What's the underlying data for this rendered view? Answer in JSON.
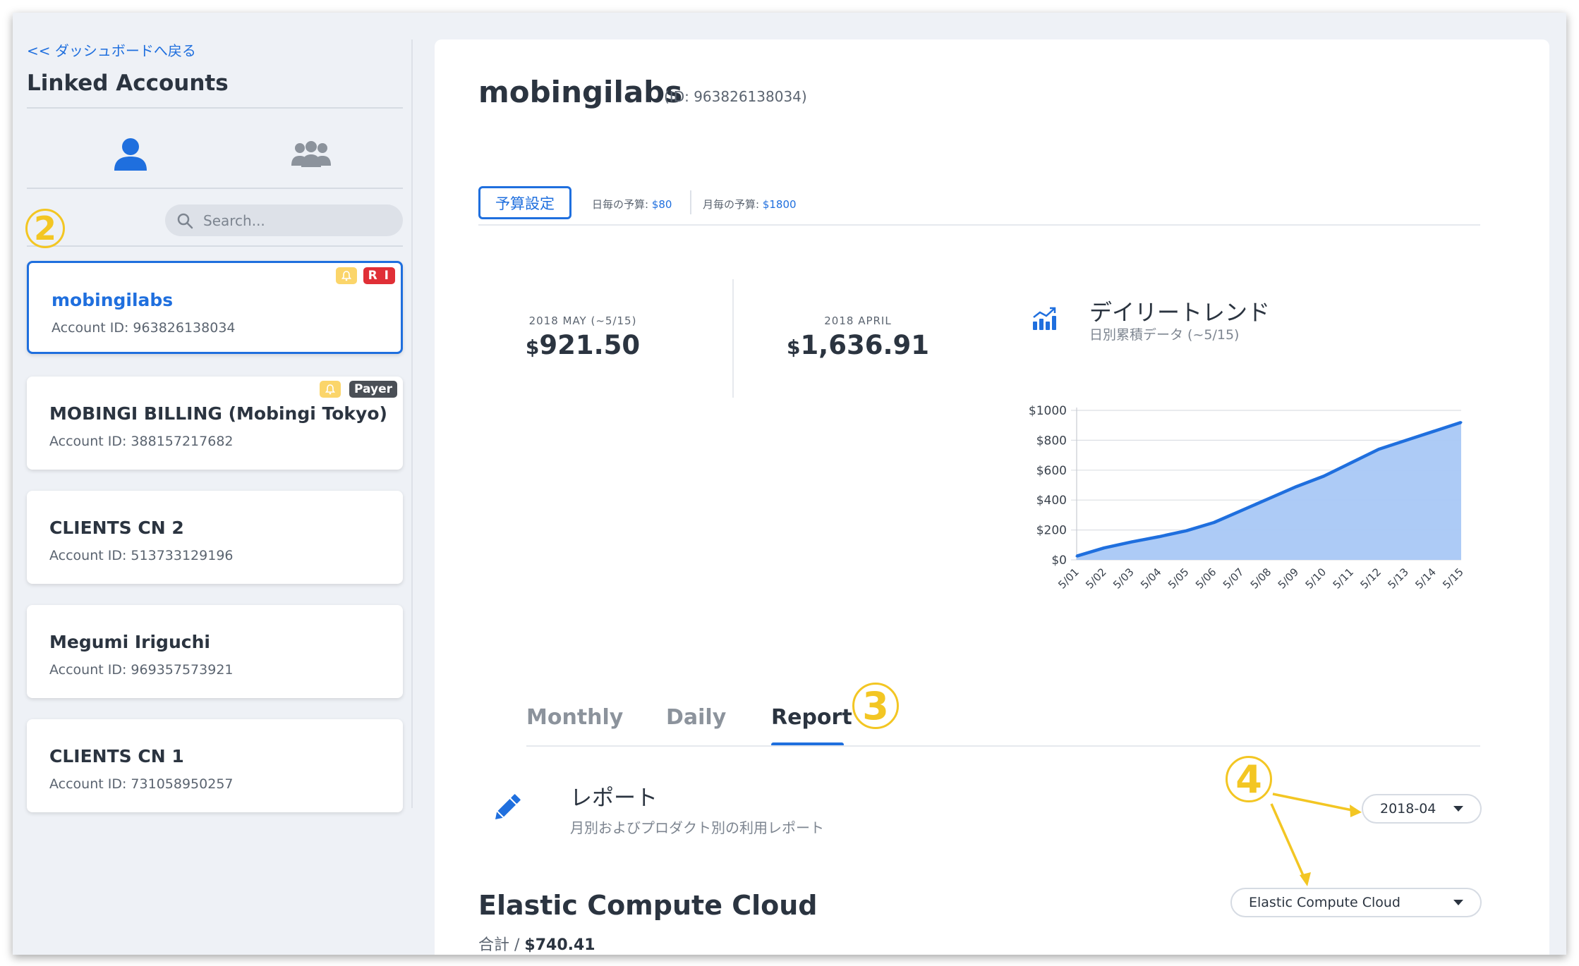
{
  "sidebar": {
    "back_link": "<< ダッシュボードへ戻る",
    "title": "Linked Accounts",
    "search_placeholder": "Search...",
    "accounts": [
      {
        "name": "mobingilabs",
        "id_label": "Account ID: 963826138034",
        "badge": "R I",
        "badge_color": "#e02f36",
        "bell": true,
        "active": true
      },
      {
        "name": "MOBINGI BILLING (Mobingi Tokyo)",
        "id_label": "Account ID: 388157217682",
        "badge": "Payer",
        "badge_color": "#4a4f56",
        "bell": true,
        "active": false
      },
      {
        "name": "CLIENTS CN 2",
        "id_label": "Account ID: 513733129196",
        "active": false
      },
      {
        "name": "Megumi Iriguchi",
        "id_label": "Account ID: 969357573921",
        "active": false
      },
      {
        "name": "CLIENTS CN 1",
        "id_label": "Account ID: 731058950257",
        "active": false
      }
    ]
  },
  "callouts": {
    "two": "2",
    "three": "3",
    "four": "4"
  },
  "main": {
    "account_name": "mobingilabs",
    "account_id": "(ID: 963826138034)",
    "budget_button": "予算設定",
    "daily_budget_label": "日毎の予算:",
    "daily_budget_value": "$80",
    "monthly_budget_label": "月毎の予算:",
    "monthly_budget_value": "$1800",
    "stats": [
      {
        "label": "2018 MAY (~5/15)",
        "currency": "$",
        "value": "921.50"
      },
      {
        "label": "2018 APRIL",
        "currency": "$",
        "value": "1,636.91"
      }
    ],
    "chart_title": "デイリートレンド",
    "chart_subtitle": "日別累積データ (~5/15)",
    "tabs": [
      "Monthly",
      "Daily",
      "Report"
    ],
    "active_tab": "Report",
    "report_title": "レポート",
    "report_subtitle": "月別およびプロダクト別の利用レポート",
    "month_select": "2018-04",
    "service_select": "Elastic Compute Cloud",
    "service_title": "Elastic Compute Cloud",
    "service_total_label": "合計 / ",
    "service_total_value": "$740.41"
  },
  "colors": {
    "accent": "#1f6fde",
    "callout": "#f3c623",
    "area_fill": "#a9c8f5"
  },
  "chart_data": {
    "type": "area",
    "categories": [
      "5/01",
      "5/02",
      "5/03",
      "5/04",
      "5/05",
      "5/06",
      "5/07",
      "5/08",
      "5/09",
      "5/10",
      "5/11",
      "5/12",
      "5/13",
      "5/14",
      "5/15"
    ],
    "values": [
      25,
      80,
      120,
      155,
      195,
      250,
      330,
      410,
      490,
      560,
      650,
      740,
      800,
      860,
      920
    ],
    "y_ticks": [
      "$0",
      "$200",
      "$400",
      "$600",
      "$800",
      "$1000"
    ],
    "ylim": [
      0,
      1000
    ],
    "grid": true
  }
}
